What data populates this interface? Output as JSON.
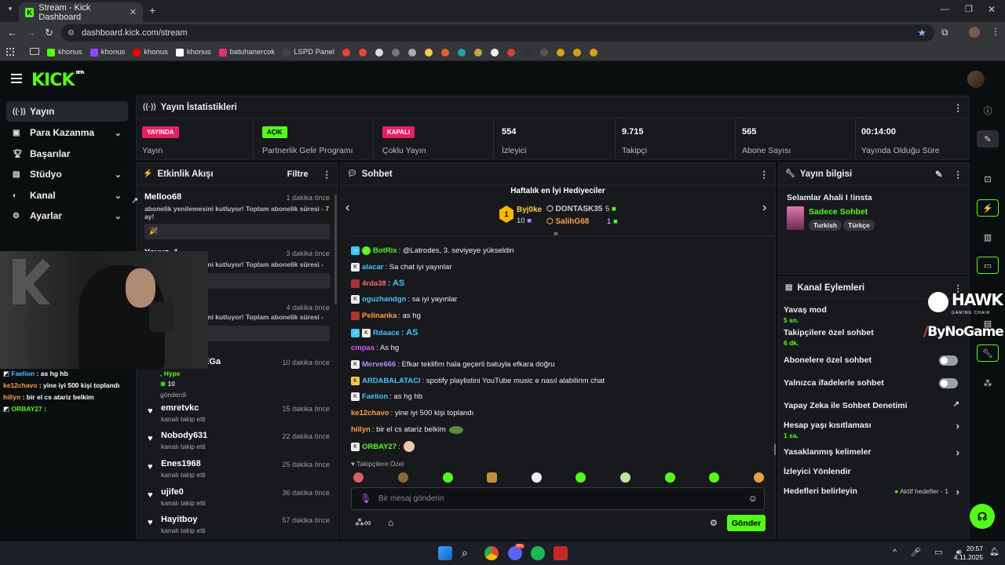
{
  "browser": {
    "tab_title": "Stream - Kick Dashboard",
    "url": "dashboard.kick.com/stream",
    "bookmarks": [
      "khonus",
      "khonus",
      "khonus",
      "khonus",
      "batuhanercok",
      "LSPD Panel"
    ]
  },
  "app": {
    "logo": "KICK",
    "logo_sup": "BETA"
  },
  "sidebar": {
    "items": [
      {
        "label": "Yayın",
        "icon": "broadcast-icon",
        "active": true,
        "chevron": false
      },
      {
        "label": "Para Kazanma",
        "icon": "money-icon",
        "chevron": true
      },
      {
        "label": "Başarılar",
        "icon": "trophy-icon",
        "chevron": false
      },
      {
        "label": "Stüdyo",
        "icon": "studio-icon",
        "chevron": true
      },
      {
        "label": "Kanal",
        "icon": "channel-icon",
        "chevron": true
      },
      {
        "label": "Ayarlar",
        "icon": "gear-icon",
        "chevron": true
      }
    ]
  },
  "stats": {
    "title": "Yayın İstatistikleri",
    "items": [
      {
        "badge": "YAYINDA",
        "badge_color": "#e91e63",
        "label": "Yayın"
      },
      {
        "badge": "AÇIK",
        "badge_color": "#53fc18",
        "label": "Partnerlik Gelir Programı"
      },
      {
        "badge": "KAPALI",
        "badge_color": "#e91e63",
        "label": "Çoklu Yayın"
      },
      {
        "value": "554",
        "label": "İzleyici"
      },
      {
        "value": "9.715",
        "label": "Takipçi"
      },
      {
        "value": "565",
        "label": "Abone Sayısı"
      },
      {
        "value": "00:14:00",
        "label": "Yayında Olduğu Süre"
      }
    ]
  },
  "activity": {
    "title": "Etkinlik Akışı",
    "filter": "Filtre",
    "items": [
      {
        "name": "Melloo68",
        "time": "1 dakika önce",
        "text": "abonelik yenilemesini kutluyor! Toplam abonelik süresi - ",
        "months": "7",
        "unit": " ay!",
        "msg": "🎉"
      },
      {
        "name": "Yavuz_1",
        "time": "3 dakika önce",
        "text": "abonelik yenilemesini kutluyor! Toplam abonelik süresi -"
      },
      {
        "name": "",
        "time": "4 dakika önce",
        "text": "abonelik yenilemesini kutluyor! Toplam abonelik süresi -"
      },
      {
        "name": "EGa",
        "time": "10 dakika önce",
        "text": ", Hype",
        "gift": "10",
        "gift_label": "gönderdi"
      },
      {
        "name": "emretvkc",
        "time": "15 dakika önce",
        "sub": "kanalı takip etti"
      },
      {
        "name": "Nobody631",
        "time": "22 dakika önce",
        "sub": "kanalı takip etti"
      },
      {
        "name": "Enes1968",
        "time": "25 dakika önce",
        "sub": "kanalı takip etti"
      },
      {
        "name": "ujife0",
        "time": "36 dakika önce",
        "sub": "kanalı takip etti"
      },
      {
        "name": "Hayitboy",
        "time": "57 dakika önce",
        "sub": "kanalı takip etti"
      }
    ]
  },
  "chat": {
    "title": "Sohbet",
    "gifters_title": "Haftalık en İyi Hediyeciler",
    "gifters": [
      {
        "rank": "1",
        "name": "Byj0ke",
        "count": "10"
      },
      {
        "name": "DONTASK35",
        "count": "5"
      },
      {
        "name": "SalihG68",
        "count": "1"
      }
    ],
    "messages": [
      {
        "user": "BotRix",
        "color": "#53fc18",
        "text": ": @Latrodes, 3. seviyeye yükseldin"
      },
      {
        "user": "alacar",
        "color": "#3ec7ff",
        "text": ": Sa chat iyi yayınlar"
      },
      {
        "user": "4rda38",
        "color": "#ff6b6b",
        "text": ": AS"
      },
      {
        "user": "oguzhandgn",
        "color": "#3ec7ff",
        "text": ": sa iyi yayınlar"
      },
      {
        "user": "Pelinanka",
        "color": "#ff9f43",
        "text": ": as hg"
      },
      {
        "user": "Rdaace",
        "color": "#3ec7ff",
        "text": ": AS"
      },
      {
        "user": "cmpas",
        "color": "#e056fd",
        "text": ": As hg"
      },
      {
        "user": "Merve666",
        "color": "#b388ff",
        "text": ": Efkar teklifim hala geçerli batuyla efkara doğru"
      },
      {
        "user": "ARDABALATACI",
        "color": "#3ec7ff",
        "text": ": spotify playlistini YouTube music e nasıl alabilirim chat"
      },
      {
        "user": "Faelion",
        "color": "#3ec7ff",
        "text": ": as hg hb"
      },
      {
        "user": "ke12chavo",
        "color": "#ff9f43",
        "text": ": yine iyi 500 kişi toplandı"
      },
      {
        "user": "hillyn",
        "color": "#ff9f43",
        "text": ": bir el cs atariz belkim"
      },
      {
        "user": "ORBAY27",
        "color": "#53fc18",
        "text": ":"
      }
    ],
    "followers_only": "Takipçilere Özel",
    "input_placeholder": "Bir mesaj gönderin",
    "send": "Gönder"
  },
  "stream_info": {
    "title": "Yayın bilgisi",
    "stream_title": "Selamlar Ahali I !insta",
    "category": "Sadece Sohbet",
    "tags": [
      "Turkish",
      "Türkçe"
    ]
  },
  "channel_actions": {
    "title": "Kanal Eylemleri",
    "items": [
      {
        "label": "Yavaş mod",
        "value": "5 sn."
      },
      {
        "label": "Takipçilere özel sohbet",
        "value": "6 dk."
      },
      {
        "label": "Abonelere özel sohbet",
        "toggle": true
      },
      {
        "label": "Yalnızca ifadelerle sohbet",
        "toggle": true
      },
      {
        "label": "Yapay Zeka ile Sohbet Denetimi"
      },
      {
        "label": "Hesap yaşı kısıtlaması",
        "value": "1 sa."
      },
      {
        "label": "Yasaklanmış kelimeler"
      },
      {
        "label": "İzleyici Yönlendir"
      },
      {
        "label": "Hedefleri belirleyin",
        "extra": "Aktif hedefler - 1"
      }
    ]
  },
  "overlay": {
    "brand1": "HAWK",
    "brand1_sub": "GAMING CHAIR",
    "brand2": "ByNoGame",
    "chat": [
      {
        "user": "Faelion",
        "text": " : as hg hb",
        "color": "#3ec7ff"
      },
      {
        "user": "ke12chavo",
        "text": " : yine iyi 500 kişi toplandı",
        "color": "#ff9f43"
      },
      {
        "user": "hillyn",
        "text": " : bir el cs atariz belkim",
        "color": "#ff9f43"
      },
      {
        "user": "ORBAY27",
        "text": " :",
        "color": "#53fc18"
      }
    ]
  },
  "taskbar": {
    "time": "20:57",
    "date": "4.11.2025",
    "discord_badge": "99+"
  }
}
